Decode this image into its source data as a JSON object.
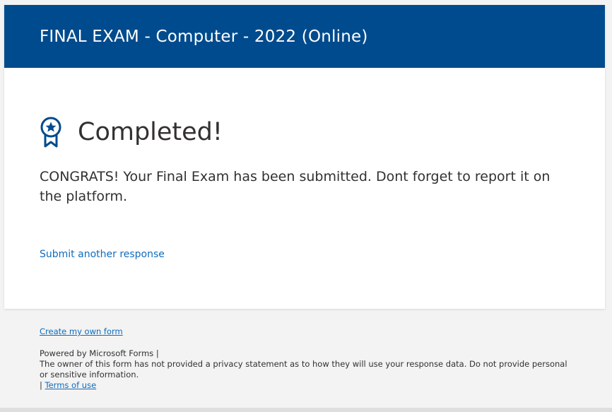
{
  "header": {
    "title": "FINAL EXAM - Computer - 2022 (Online)"
  },
  "confirmation": {
    "icon": "ribbon-award-icon",
    "title": "Completed!",
    "message": "CONGRATS!  Your Final Exam has been submitted.  Dont forget to report it on the platform.",
    "submit_another_label": "Submit another response"
  },
  "footer": {
    "create_form_label": "Create my own form",
    "powered_by": "Powered by Microsoft Forms |",
    "privacy_notice": "The owner of this form has not provided a privacy statement as to how they will use your response data. Do not provide personal or sensitive information.",
    "separator": "|",
    "terms_label": "Terms of use"
  },
  "colors": {
    "header_bg": "#004b8d",
    "link": "#0f6cbd",
    "text": "#323130",
    "page_bg": "#f3f3f3"
  }
}
